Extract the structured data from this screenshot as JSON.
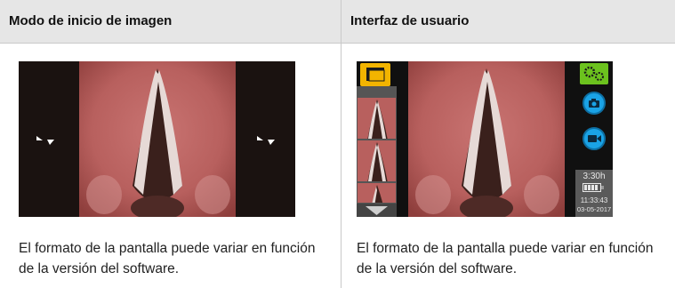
{
  "columns": [
    {
      "header": "Modo de inicio de imagen",
      "caption": "El formato de la pantalla puede variar en función de la versión del software."
    },
    {
      "header": "Interfaz de usuario",
      "caption": "El formato de la pantalla puede variar en función de la versión del software."
    }
  ],
  "ui": {
    "battery_time": "3:30h",
    "time": "11:33:43",
    "date": "03-05-2017"
  },
  "icons": {
    "rotate_left": "rotate-icon",
    "rotate_right": "rotate-icon",
    "folder": "folder-icon",
    "settings": "gear-icon",
    "camera": "camera-icon",
    "video": "video-camera-icon",
    "battery": "battery-icon",
    "scroll_down": "triangle-down-icon"
  },
  "colors": {
    "header_bg": "#e6e6e6",
    "tissue": "#b8605e",
    "button_blue": "#1aa3e6",
    "folder_yellow": "#f2b400",
    "settings_green": "#6cc21e"
  }
}
